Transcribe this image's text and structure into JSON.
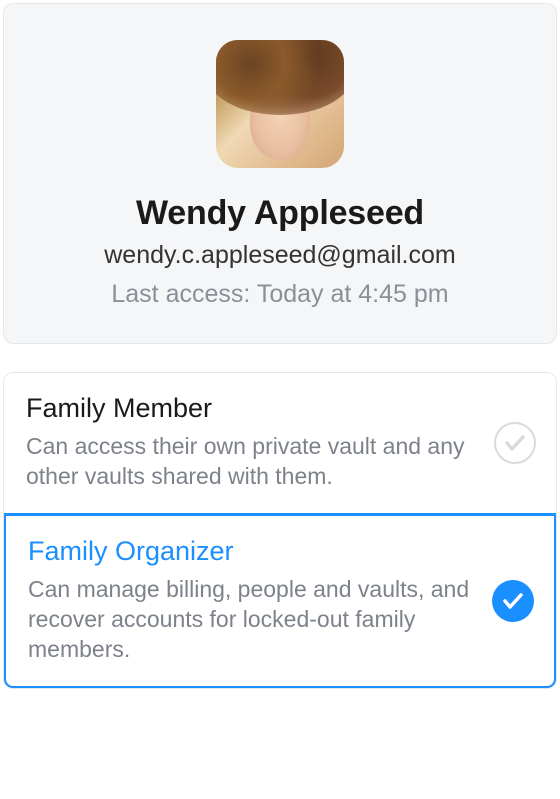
{
  "profile": {
    "name": "Wendy Appleseed",
    "email": "wendy.c.appleseed@gmail.com",
    "last_access": "Last access: Today at 4:45 pm"
  },
  "roles": [
    {
      "title": "Family Member",
      "description": "Can access their own private vault and any other vaults shared with them.",
      "selected": false
    },
    {
      "title": "Family Organizer",
      "description": "Can manage billing, people and vaults, and recover accounts for locked-out family members.",
      "selected": true
    }
  ]
}
